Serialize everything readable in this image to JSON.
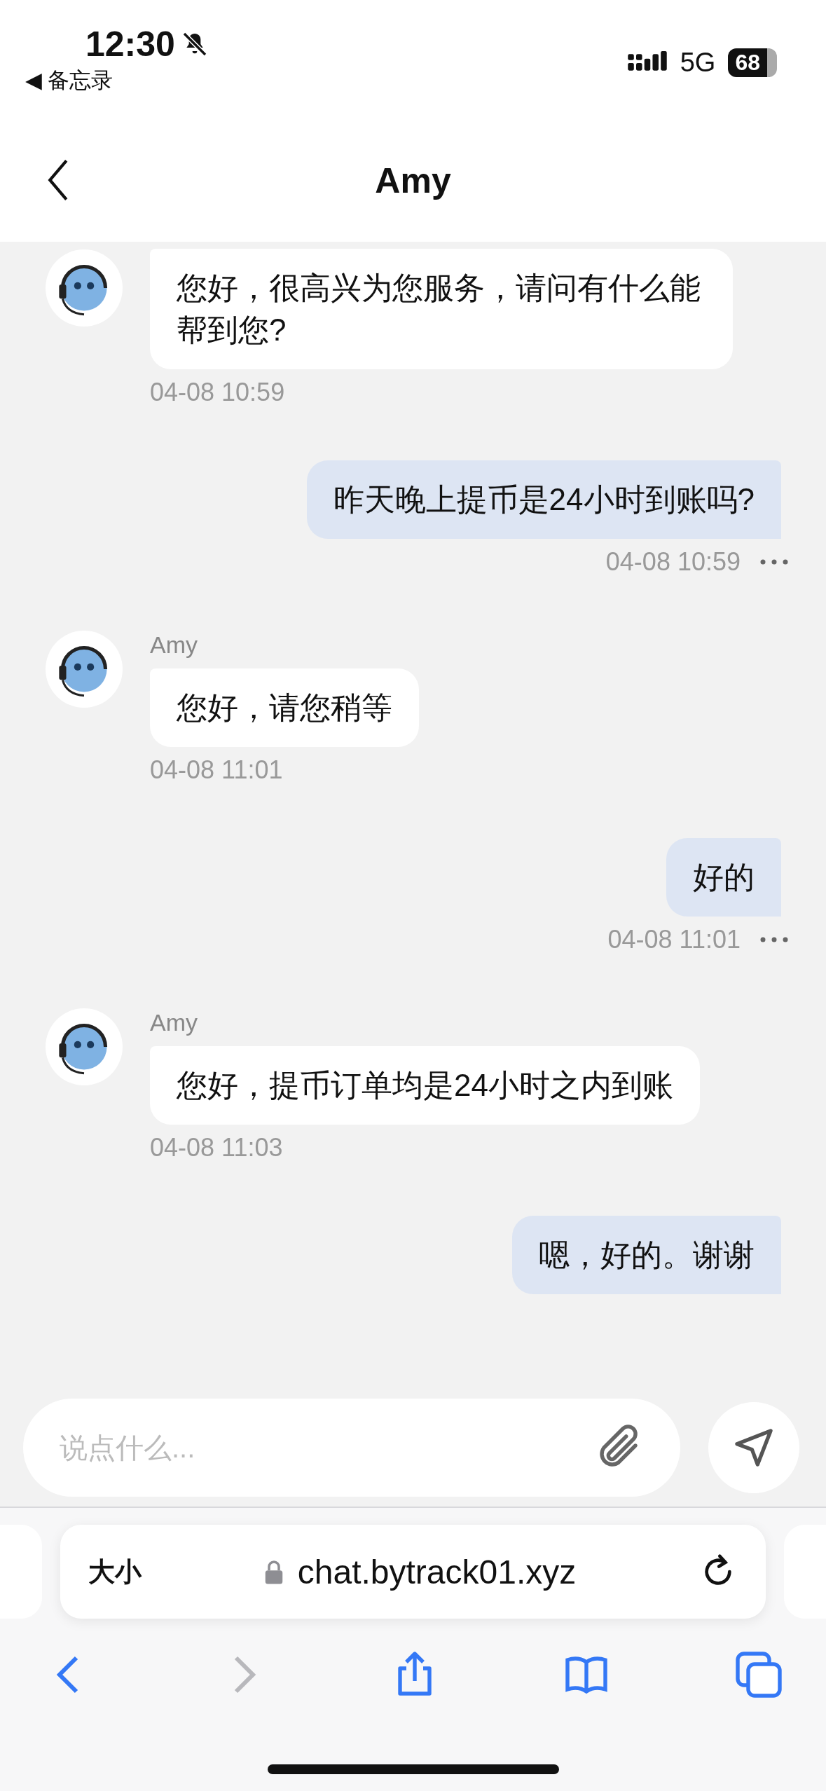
{
  "status_bar": {
    "time": "12:30",
    "back_app": "◀ 备忘录",
    "network": "5G",
    "battery": "68"
  },
  "nav": {
    "title": "Amy"
  },
  "messages": [
    {
      "kind": "agent",
      "text": "您好，很高兴为您服务，请问有什么能帮到您?",
      "time": "04-08 10:59"
    },
    {
      "kind": "user",
      "text": "昨天晚上提币是24小时到账吗?",
      "time": "04-08 10:59"
    },
    {
      "kind": "agent",
      "name": "Amy",
      "text": "您好，请您稍等",
      "time": "04-08 11:01"
    },
    {
      "kind": "user",
      "text": "好的",
      "time": "04-08 11:01"
    },
    {
      "kind": "agent",
      "name": "Amy",
      "text": "您好，提币订单均是24小时之内到账",
      "time": "04-08 11:03"
    },
    {
      "kind": "user",
      "text": "嗯，好的。谢谢"
    }
  ],
  "composer": {
    "placeholder": "说点什么..."
  },
  "browser": {
    "text_size": "大小",
    "url": "chat.bytrack01.xyz"
  }
}
